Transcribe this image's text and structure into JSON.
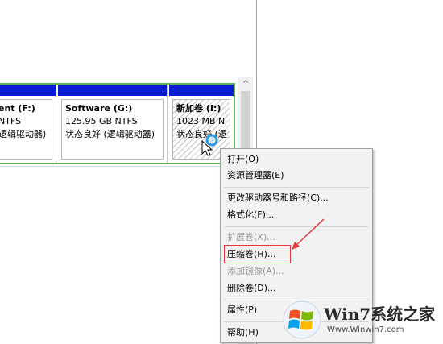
{
  "volumes": [
    {
      "name": "ent  (F:)",
      "size": "NTFS",
      "status": "逻辑驱动器)"
    },
    {
      "name": "Software  (G:)",
      "size": "125.95 GB NTFS",
      "status": "状态良好 (逻辑驱动器)"
    },
    {
      "name": "新加卷  (I:)",
      "size": "1023 MB N",
      "status": "状态良好 (逻"
    }
  ],
  "context_menu": {
    "items": [
      {
        "label": "打开(O)",
        "enabled": true
      },
      {
        "label": "资源管理器(E)",
        "enabled": true
      },
      {
        "label": "更改驱动器号和路径(C)...",
        "enabled": true
      },
      {
        "label": "格式化(F)...",
        "enabled": true
      },
      {
        "label": "扩展卷(X)...",
        "enabled": false
      },
      {
        "label": "压缩卷(H)...",
        "enabled": true,
        "highlighted": true
      },
      {
        "label": "添加镜像(A)...",
        "enabled": false
      },
      {
        "label": "删除卷(D)...",
        "enabled": true
      },
      {
        "label": "属性(P)",
        "enabled": true
      },
      {
        "label": "帮助(H)",
        "enabled": true
      }
    ]
  },
  "scrollbar": {
    "up_arrow": "^"
  },
  "watermark": {
    "title": "Win7系统之家",
    "url": "Www.Winwin7.com"
  },
  "colors": {
    "volume_bar": "#0a1bd6",
    "selection_border": "#5ab55a",
    "annotation": "#e33b3b",
    "menu_bg": "#f2f2f2"
  }
}
